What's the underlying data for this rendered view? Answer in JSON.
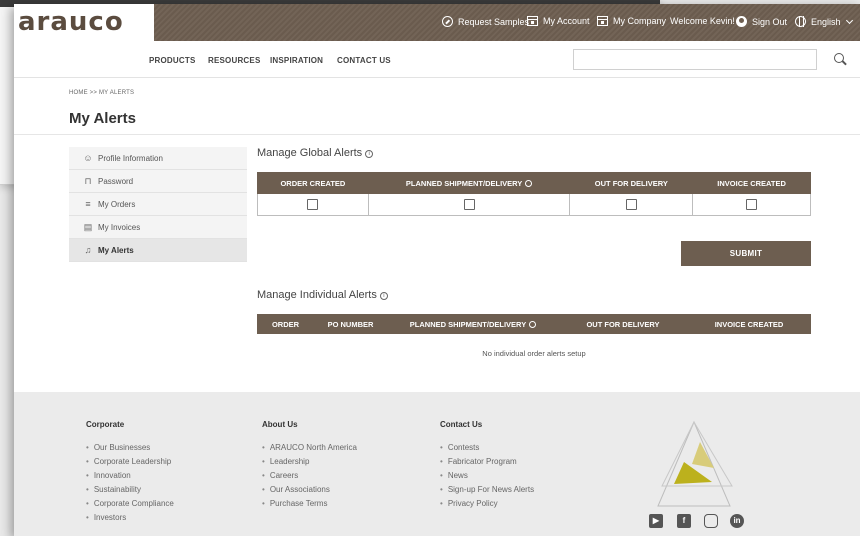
{
  "brand": {
    "logo": "arauco",
    "accent": "#6d5e50"
  },
  "topbar": {
    "request_samples": "Request Samples",
    "my_account": "My Account",
    "my_company": "My Company",
    "welcome": "Welcome Kevin!",
    "sign_out": "Sign Out",
    "language": "English"
  },
  "nav": {
    "items": [
      "PRODUCTS",
      "RESOURCES",
      "INSPIRATION",
      "CONTACT US"
    ],
    "search_placeholder": ""
  },
  "breadcrumb": "HOME >> MY ALERTS",
  "page_title": "My Alerts",
  "sidebar": {
    "items": [
      {
        "label": "Profile Information",
        "icon": "profile-icon"
      },
      {
        "label": "Password",
        "icon": "lock-icon"
      },
      {
        "label": "My Orders",
        "icon": "list-icon"
      },
      {
        "label": "My Invoices",
        "icon": "invoice-icon"
      },
      {
        "label": "My Alerts",
        "icon": "bell-icon",
        "active": true
      }
    ]
  },
  "global_alerts": {
    "title": "Manage Global Alerts",
    "columns": [
      "ORDER CREATED",
      "PLANNED SHIPMENT/DELIVERY",
      "OUT FOR DELIVERY",
      "INVOICE CREATED"
    ],
    "checked": [
      false,
      false,
      false,
      false
    ],
    "submit_label": "SUBMIT"
  },
  "individual_alerts": {
    "title": "Manage Individual Alerts",
    "columns": [
      "ORDER",
      "PO NUMBER",
      "PLANNED SHIPMENT/DELIVERY",
      "OUT FOR DELIVERY",
      "INVOICE CREATED"
    ],
    "empty_message": "No individual order alerts setup"
  },
  "footer": {
    "corporate": {
      "title": "Corporate",
      "links": [
        "Our Businesses",
        "Corporate Leadership",
        "Innovation",
        "Sustainability",
        "Corporate Compliance",
        "Investors"
      ]
    },
    "about": {
      "title": "About Us",
      "links": [
        "ARAUCO North America",
        "Leadership",
        "Careers",
        "Our Associations",
        "Purchase Terms"
      ]
    },
    "contact": {
      "title": "Contact Us",
      "links": [
        "Contests",
        "Fabricator Program",
        "News",
        "Sign-up For News Alerts",
        "Privacy Policy"
      ]
    },
    "social": [
      "youtube-icon",
      "facebook-icon",
      "instagram-icon",
      "linkedin-icon"
    ]
  }
}
